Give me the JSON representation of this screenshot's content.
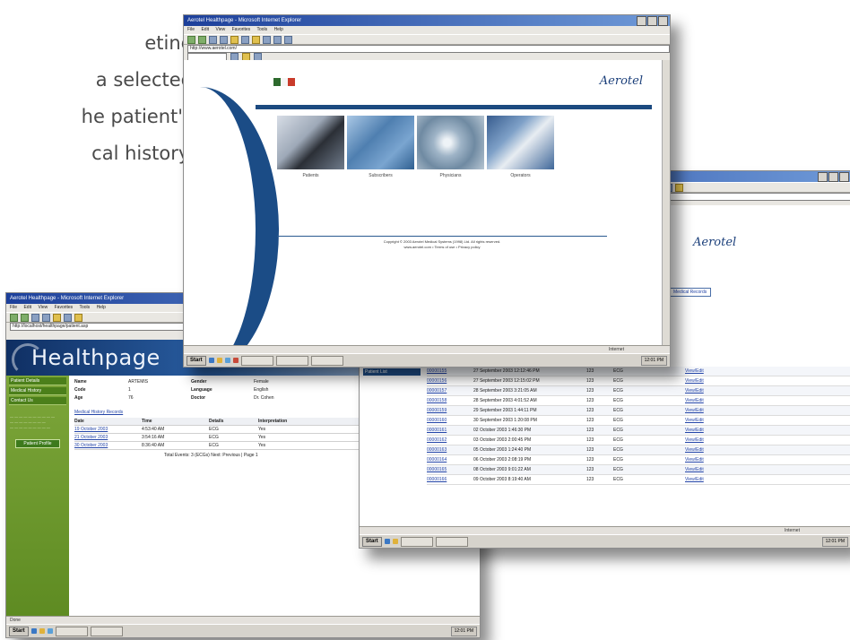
{
  "intro_lines": [
    "eting",
    "a selected",
    "he patient's",
    "cal history."
  ],
  "windows": {
    "healthpage": {
      "title": "Aerotel Healthpage - Microsoft Internet Explorer",
      "menu": [
        "File",
        "Edit",
        "View",
        "Favorites",
        "Tools",
        "Help"
      ],
      "brand": "Healthpage",
      "address": "http://localhost/healthpage/patient.asp",
      "nav": [
        "Patient Details",
        "Medical History",
        "Contact Us"
      ],
      "side_button": "Patient Profile",
      "patient_fields": [
        {
          "label": "Name",
          "value": "ARTEMIS"
        },
        {
          "label": "Gender",
          "value": "Female"
        },
        {
          "label": "Code",
          "value": "1"
        },
        {
          "label": "Language",
          "value": "English"
        },
        {
          "label": "Age",
          "value": "76"
        },
        {
          "label": "Doctor",
          "value": "Dr. Cohen"
        }
      ],
      "section_link": "Medical History Records",
      "table_headers": [
        "Date",
        "Time",
        "Details",
        "Interpretation"
      ],
      "rows": [
        [
          "19 October 2003",
          "4:53:40 AM",
          "ECG",
          "Yes"
        ],
        [
          "21 October 2003",
          "3:54:16 AM",
          "ECG",
          "Yes"
        ],
        [
          "30 October 2003",
          "8:36:40 AM",
          "ECG",
          "Yes"
        ]
      ],
      "footer": "Total Events: 3 (ECGs)  Next: Previous | Page 1",
      "status": "Done"
    },
    "aerotel": {
      "title": "Aerotel Healthpage - Microsoft Internet Explorer",
      "menu": [
        "File",
        "Edit",
        "View",
        "Favorites",
        "Tools",
        "Help"
      ],
      "address": "http://www.aerotel.com/",
      "logo": "Aerotel",
      "captions": [
        "Patients",
        "Subscribers",
        "Physicians",
        "Operators"
      ],
      "footer_line1": "Copyright © 2003 Aerotel Medical Systems (1998) Ltd. All rights reserved.",
      "footer_line2": "www.aerotel.com  •  Terms of use  •  Privacy policy",
      "status": "Internet"
    },
    "records": {
      "logo": "Aerotel",
      "tab": "Medical Records",
      "side_button": "Patient List",
      "rows": [
        [
          "00000155",
          "27 September 2003 12:12:46 PM",
          "123",
          "ECG",
          "View/Edit"
        ],
        [
          "00000156",
          "27 September 2003 12:15:02 PM",
          "123",
          "ECG",
          "View/Edit"
        ],
        [
          "00000157",
          "28 September 2003 3:21:05 AM",
          "123",
          "ECG",
          "View/Edit"
        ],
        [
          "00000158",
          "28 September 2003 4:01:52 AM",
          "123",
          "ECG",
          "View/Edit"
        ],
        [
          "00000159",
          "29 September 2003 1:44:11 PM",
          "123",
          "ECG",
          "View/Edit"
        ],
        [
          "00000160",
          "30 September 2003 1:20:08 PM",
          "123",
          "ECG",
          "View/Edit"
        ],
        [
          "00000161",
          "02 October 2003 1:46:30 PM",
          "123",
          "ECG",
          "View/Edit"
        ],
        [
          "00000162",
          "03 October 2003 2:00:45 PM",
          "123",
          "ECG",
          "View/Edit"
        ],
        [
          "00000163",
          "05 October 2003 1:24:40 PM",
          "123",
          "ECG",
          "View/Edit"
        ],
        [
          "00000164",
          "06 October 2003 2:08:19 PM",
          "123",
          "ECG",
          "View/Edit"
        ],
        [
          "00000165",
          "08 October 2003 9:01:22 AM",
          "123",
          "ECG",
          "View/Edit"
        ],
        [
          "00000166",
          "09 October 2003 8:19:40 AM",
          "123",
          "ECG",
          "View/Edit"
        ]
      ],
      "status": "Internet"
    }
  },
  "taskbar": {
    "start": "Start",
    "clock": "12:01 PM"
  }
}
